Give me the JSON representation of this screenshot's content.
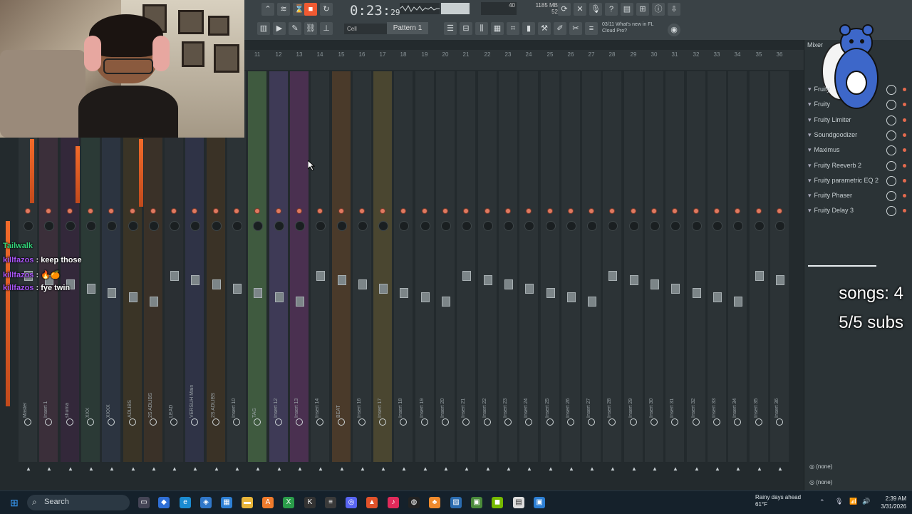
{
  "toolbar": {
    "time_main": "0:23",
    "time_sub": "29",
    "time_units": "M:S:CS",
    "cpu_value": "40",
    "mem_value": "1185 MB",
    "voices": "52",
    "snap": "Cell",
    "pattern": "Pattern 1",
    "news_date": "03/11",
    "news_text": "What's new in FL",
    "news_text2": "Cloud Pro?"
  },
  "mixer": {
    "track_numbers": [
      "11",
      "12",
      "13",
      "14",
      "15",
      "16",
      "17",
      "18",
      "19",
      "20",
      "21",
      "22",
      "23",
      "24",
      "25",
      "26",
      "27",
      "28",
      "29",
      "30",
      "31",
      "32",
      "33",
      "34",
      "35",
      "36"
    ],
    "strips": [
      {
        "label": "Master",
        "color": "#2c3336"
      },
      {
        "label": "Insert 1",
        "color": "#3b2f3a"
      },
      {
        "label": "shuma",
        "color": "#33283a"
      },
      {
        "label": "XXX",
        "color": "#2b3a36"
      },
      {
        "label": "XXXX",
        "color": "#2c3440"
      },
      {
        "label": "ADLIBS",
        "color": "#3a3426"
      },
      {
        "label": "2S ADLIBS",
        "color": "#3a3128"
      },
      {
        "label": "LEAD",
        "color": "#2a2f33"
      },
      {
        "label": "VERSUH Main",
        "color": "#2f3346"
      },
      {
        "label": "2S ADLIBS",
        "color": "#3a3226"
      },
      {
        "label": "Insert 10",
        "color": "#2c3336"
      },
      {
        "label": "TAG",
        "color": "#3f5a3f"
      },
      {
        "label": "Insert 12",
        "color": "#3e3a56"
      },
      {
        "label": "Insert 13",
        "color": "#4a3050"
      },
      {
        "label": "Insert 14",
        "color": "#2c3336"
      },
      {
        "label": "BEAT",
        "color": "#4a3a2a"
      },
      {
        "label": "Insert 16",
        "color": "#2c3336"
      },
      {
        "label": "Insert 17",
        "color": "#4a4630"
      },
      {
        "label": "Insert 18",
        "color": "#2c3336"
      },
      {
        "label": "Insert 19",
        "color": "#2c3336"
      },
      {
        "label": "Insert 20",
        "color": "#2c3336"
      },
      {
        "label": "Insert 21",
        "color": "#2c3336"
      },
      {
        "label": "Insert 22",
        "color": "#2c3336"
      },
      {
        "label": "Insert 23",
        "color": "#2c3336"
      },
      {
        "label": "Insert 24",
        "color": "#2c3336"
      },
      {
        "label": "Insert 25",
        "color": "#2c3336"
      },
      {
        "label": "Insert 26",
        "color": "#2c3336"
      },
      {
        "label": "Insert 27",
        "color": "#2c3336"
      },
      {
        "label": "Insert 28",
        "color": "#2c3336"
      },
      {
        "label": "Insert 29",
        "color": "#2c3336"
      },
      {
        "label": "Insert 30",
        "color": "#2c3336"
      },
      {
        "label": "Insert 31",
        "color": "#2c3336"
      },
      {
        "label": "Insert 32",
        "color": "#2c3336"
      },
      {
        "label": "Insert 33",
        "color": "#2c3336"
      },
      {
        "label": "Insert 34",
        "color": "#2c3336"
      },
      {
        "label": "Insert 35",
        "color": "#2c3336"
      },
      {
        "label": "Insert 36",
        "color": "#2c3336"
      }
    ]
  },
  "chat": [
    {
      "user": "Tailwalk",
      "text": "",
      "green": true
    },
    {
      "user": "killfazos",
      "text": "keep those"
    },
    {
      "user": "killfazos",
      "text": ""
    },
    {
      "user": "killfazos",
      "text": "fye twin"
    }
  ],
  "panel": {
    "title": "Mixer",
    "fx": [
      "Fruity",
      "Fruity",
      "Fruity Limiter",
      "Soundgoodizer",
      "Maximus",
      "Fruity Reeverb 2",
      "Fruity parametric EQ 2",
      "Fruity Phaser",
      "Fruity Delay 3"
    ],
    "songs": "songs: 4",
    "subs": "5/5 subs",
    "none1": "(none)",
    "none2": "(none)"
  },
  "taskbar": {
    "search": "Search",
    "weather_line1": "Rainy days ahead",
    "weather_line2": "61°F",
    "time": "2:39 AM",
    "date": "3/31/2026"
  }
}
